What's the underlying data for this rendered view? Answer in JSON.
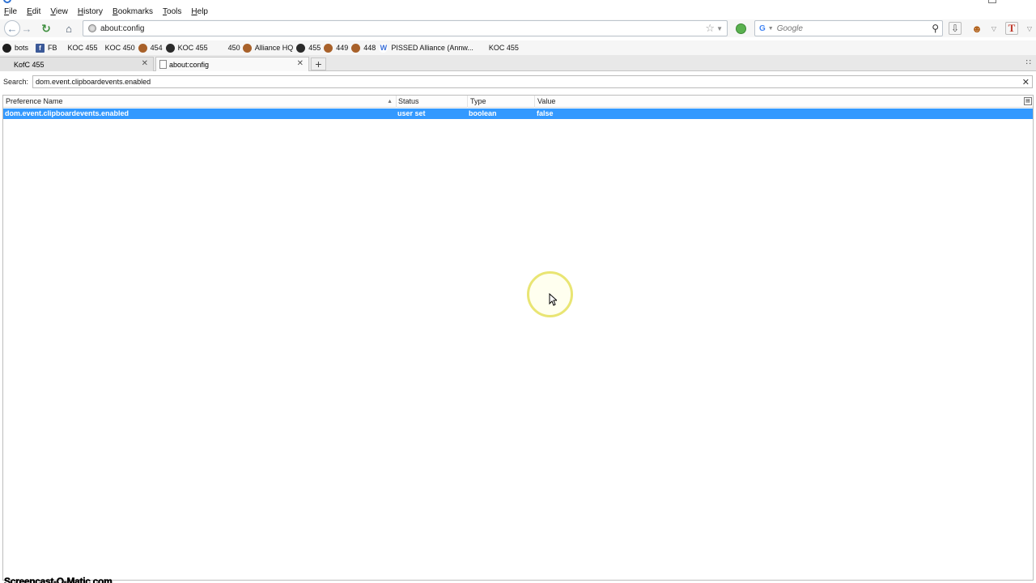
{
  "menubar": {
    "items": [
      "File",
      "Edit",
      "View",
      "History",
      "Bookmarks",
      "Tools",
      "Help"
    ]
  },
  "navbar": {
    "url": "about:config",
    "search_placeholder": "Google",
    "icons": [
      "back-icon",
      "forward-icon",
      "reload-icon",
      "home-icon",
      "bookmark-star-icon",
      "addon-icon",
      "google-icon",
      "search-icon",
      "download-icon",
      "greasemonkey-icon",
      "t-icon",
      "menu-icon"
    ]
  },
  "bookmarks": [
    {
      "label": "bots",
      "icon": "dark-circle-icon"
    },
    {
      "label": "FB",
      "icon": "facebook-icon"
    },
    {
      "label": "KOC 455",
      "icon": ""
    },
    {
      "label": "KOC 450",
      "icon": ""
    },
    {
      "label": "454",
      "icon": "lion-icon"
    },
    {
      "label": "KOC 455",
      "icon": "crown-icon"
    },
    {
      "label": "450",
      "icon": ""
    },
    {
      "label": "Alliance HQ",
      "icon": "lion-icon"
    },
    {
      "label": "455",
      "icon": "crown-icon"
    },
    {
      "label": "449",
      "icon": "lion-icon"
    },
    {
      "label": "448",
      "icon": "lion-icon"
    },
    {
      "label": "PISSED Alliance (Annw...",
      "icon": "w-icon"
    },
    {
      "label": "KOC 455",
      "icon": ""
    }
  ],
  "tabs": [
    {
      "label": "KofC 455",
      "active": false
    },
    {
      "label": "about:config",
      "active": true
    }
  ],
  "config": {
    "search_label": "Search:",
    "search_value": "dom.event.clipboardevents.enabled",
    "columns": [
      "Preference Name",
      "Status",
      "Type",
      "Value"
    ],
    "rows": [
      {
        "name": "dom.event.clipboardevents.enabled",
        "status": "user set",
        "type": "boolean",
        "value": "false"
      }
    ]
  },
  "watermark": "Screencast-O-Matic.com",
  "colors": {
    "selection": "#3399ff",
    "cursor_ring": "#e9e573"
  }
}
